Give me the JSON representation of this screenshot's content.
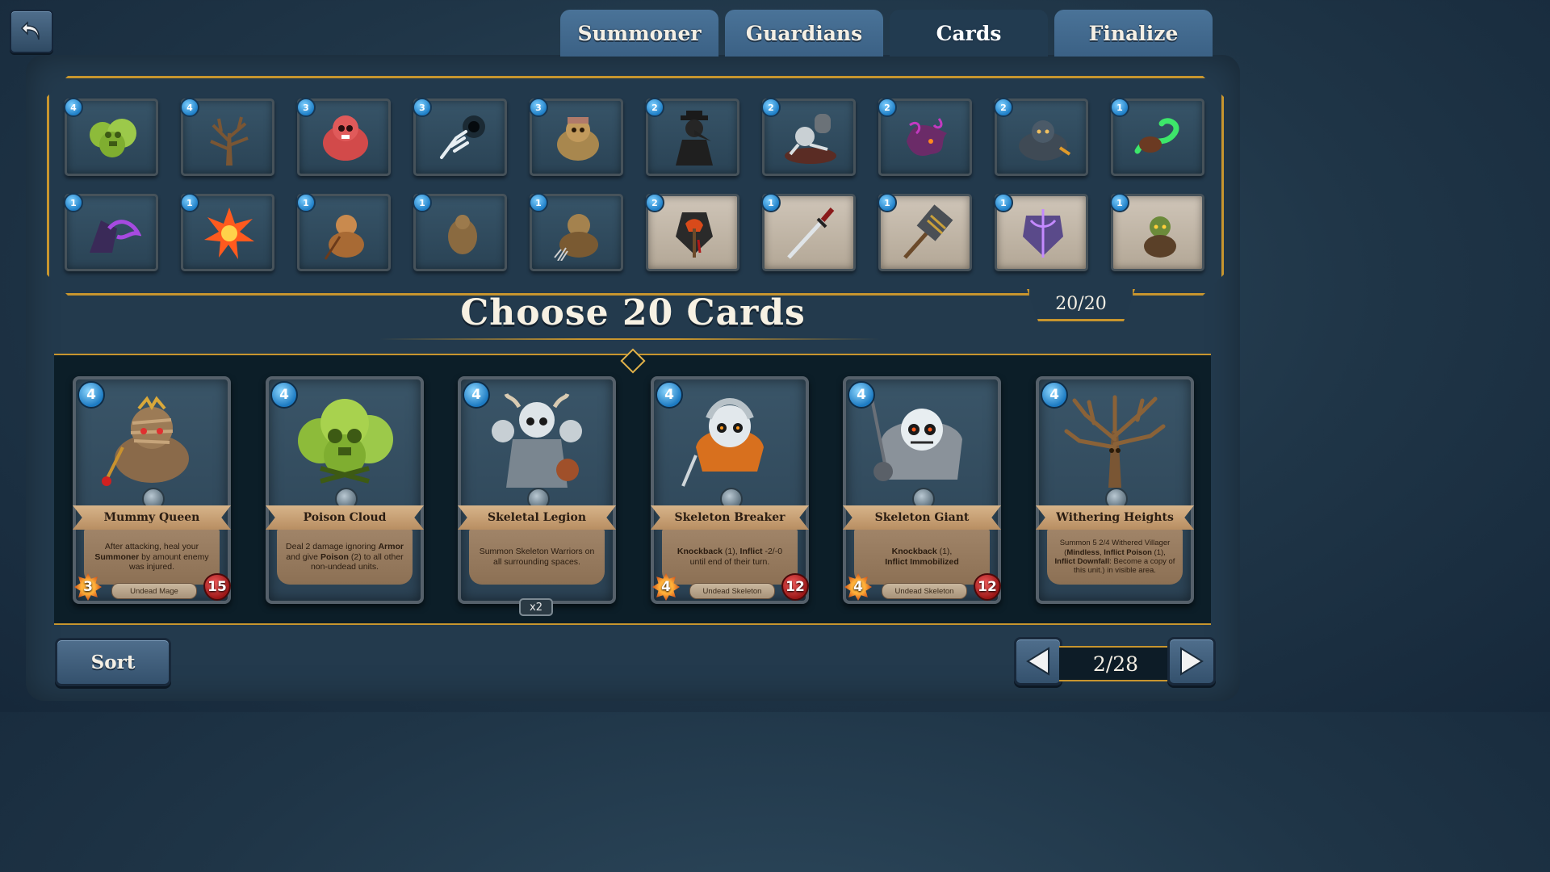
{
  "nav": {
    "back_icon": "undo-arrow-icon",
    "tabs": [
      {
        "label": "Summoner",
        "active": false
      },
      {
        "label": "Guardians",
        "active": false
      },
      {
        "label": "Cards",
        "active": true
      },
      {
        "label": "Finalize",
        "active": false
      }
    ]
  },
  "deck": {
    "count_label": "20/20",
    "thumbnails": [
      {
        "cost": "4",
        "art": "poison-cloud-art"
      },
      {
        "cost": "4",
        "art": "withered-tree-art"
      },
      {
        "cost": "3",
        "art": "red-skull-brute-art"
      },
      {
        "cost": "3",
        "art": "skeletal-hand-vortex-art"
      },
      {
        "cost": "3",
        "art": "ghoul-butcher-art"
      },
      {
        "cost": "2",
        "art": "plague-doctor-art"
      },
      {
        "cost": "2",
        "art": "rising-zombie-art"
      },
      {
        "cost": "2",
        "art": "shadow-beast-art"
      },
      {
        "cost": "2",
        "art": "armored-warrior-art"
      },
      {
        "cost": "1",
        "art": "green-serpent-art"
      },
      {
        "cost": "1",
        "art": "purple-dragon-art"
      },
      {
        "cost": "1",
        "art": "explosion-spell-art"
      },
      {
        "cost": "1",
        "art": "villager-spear-art"
      },
      {
        "cost": "1",
        "art": "crawling-beast-art"
      },
      {
        "cost": "1",
        "art": "villager-pitchfork-art"
      },
      {
        "cost": "2",
        "art": "bleeding-axe-art"
      },
      {
        "cost": "1",
        "art": "katana-art"
      },
      {
        "cost": "1",
        "art": "spiked-hammer-art"
      },
      {
        "cost": "1",
        "art": "arcane-armor-art"
      },
      {
        "cost": "1",
        "art": "goblin-art"
      }
    ]
  },
  "main": {
    "title": "Choose 20 Cards"
  },
  "cards": [
    {
      "name": "Mummy Queen",
      "cost": "4",
      "text_before": "After attacking, heal your ",
      "bold1": "Summoner",
      "text_after": " by amount enemy was injured.",
      "type": "Undead Mage",
      "attack": "3",
      "health": "15",
      "art": "mummy-queen-art"
    },
    {
      "name": "Poison Cloud",
      "cost": "4",
      "text_before": "Deal 2 damage ignoring ",
      "bold1": "Armor",
      "text_mid": " and give ",
      "bold2": "Poison",
      "text_after": " (2) to all other non-undead units.",
      "art": "poison-cloud-art"
    },
    {
      "name": "Skeletal Legion",
      "cost": "4",
      "text": "Summon Skeleton Warriors on all surrounding spaces.",
      "copies": "x2",
      "art": "skeletal-legion-art"
    },
    {
      "name": "Skeleton Breaker",
      "cost": "4",
      "bold1": "Knockback",
      "text_mid": " (1), ",
      "bold2": "Inflict",
      "text_after": " -2/-0 until end of their turn.",
      "type": "Undead Skeleton",
      "attack": "4",
      "health": "12",
      "art": "skeleton-breaker-art"
    },
    {
      "name": "Skeleton Giant",
      "cost": "4",
      "bold1": "Knockback",
      "text_mid": " (1),",
      "bold2": "Inflict Immobilized",
      "type": "Undead Skeleton",
      "attack": "4",
      "health": "12",
      "art": "skeleton-giant-art"
    },
    {
      "name": "Withering Heights",
      "cost": "4",
      "text_before": "Summon 5 2/4 Withered Villager (",
      "bold1": "Mindless",
      "text_mid": ", ",
      "bold2": "Inflict Poison",
      "text_mid2": " (1), ",
      "bold3": "Inflict Downfall",
      "text_after": ": Become a copy of this unit.) in visible area.",
      "art": "withering-tree-art"
    }
  ],
  "footer": {
    "sort_label": "Sort",
    "page_label": "2/28",
    "prev_icon": "arrow-left-icon",
    "next_icon": "arrow-right-icon"
  },
  "colors": {
    "gold_frame": "#c7952e",
    "cost_blue": "#1f7fc7",
    "attack_orange": "#ff9a2e",
    "health_red": "#b71c1c",
    "tab_blue": "#3b6185"
  }
}
